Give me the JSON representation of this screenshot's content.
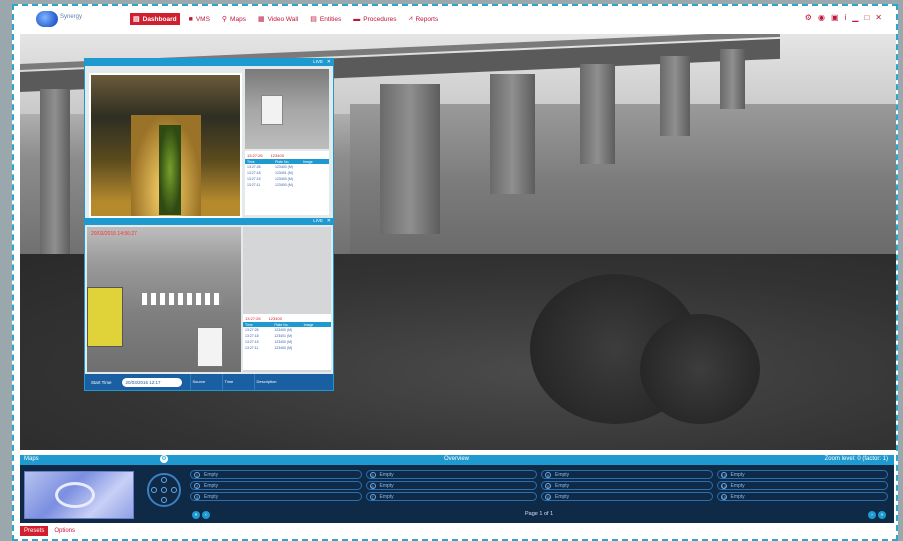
{
  "app": {
    "logo_text": "Synergy"
  },
  "nav": [
    {
      "label": "Dashboard",
      "icon": "dashboard-icon",
      "glyph": "▤",
      "active": true
    },
    {
      "label": "VMS",
      "icon": "camera-icon",
      "glyph": "■"
    },
    {
      "label": "Maps",
      "icon": "map-pin-icon",
      "glyph": "⚲"
    },
    {
      "label": "Video Wall",
      "icon": "grid-icon",
      "glyph": "▦"
    },
    {
      "label": "Entities",
      "icon": "entities-icon",
      "glyph": "▤"
    },
    {
      "label": "Procedures",
      "icon": "procedures-icon",
      "glyph": "▬"
    },
    {
      "label": "Reports",
      "icon": "chart-icon",
      "glyph": "⩘"
    }
  ],
  "window_controls": [
    "⚙",
    "◉",
    "▣",
    "i",
    "▁",
    "□",
    "✕"
  ],
  "popup": {
    "live_label": "LIVE",
    "close": "✕",
    "camera_b_timestamp": "20/03/2015 14:56:27",
    "info_a": {
      "time": "13:27:26",
      "id": "123400",
      "headers": [
        "Time",
        "Plate No.",
        "Image"
      ],
      "rows": [
        [
          "13:27:26",
          "123400 (M)",
          ""
        ],
        [
          "13:27:18",
          "123401 (M)",
          ""
        ],
        [
          "13:27:15",
          "123400 (M)",
          ""
        ],
        [
          "13:27:11",
          "123400 (M)",
          ""
        ]
      ]
    },
    "info_b": {
      "time": "13:27:26",
      "id": "123400",
      "headers": [
        "Time",
        "Plate No.",
        "Image"
      ],
      "rows": [
        [
          "13:27:26",
          "123400 (M)",
          ""
        ],
        [
          "13:27:18",
          "123401 (M)",
          ""
        ],
        [
          "13:27:15",
          "123400 (M)",
          ""
        ],
        [
          "13:27:11",
          "123400 (M)",
          ""
        ]
      ]
    },
    "footer": {
      "start_time_label": "Start Time",
      "start_time_value": "20/03/2015 12:17",
      "cols": [
        "Source",
        "Time",
        "Description"
      ]
    }
  },
  "maps": {
    "title": "Maps",
    "overview": "Overview",
    "zoom": "Zoom level: 0 (factor: 1)",
    "presets": [
      {
        "n": "1",
        "label": "Empty"
      },
      {
        "n": "5",
        "label": "Empty"
      },
      {
        "n": "9",
        "label": "Empty"
      },
      {
        "n": "13",
        "label": "Empty"
      },
      {
        "n": "2",
        "label": "Empty"
      },
      {
        "n": "6",
        "label": "Empty"
      },
      {
        "n": "10",
        "label": "Empty"
      },
      {
        "n": "14",
        "label": "Empty"
      },
      {
        "n": "3",
        "label": "Empty"
      },
      {
        "n": "7",
        "label": "Empty"
      },
      {
        "n": "11",
        "label": "Empty"
      },
      {
        "n": "15",
        "label": "Empty"
      }
    ],
    "page": "Page 1 of 1"
  },
  "tabs": [
    {
      "label": "Presets",
      "active": true
    },
    {
      "label": "Options"
    }
  ]
}
